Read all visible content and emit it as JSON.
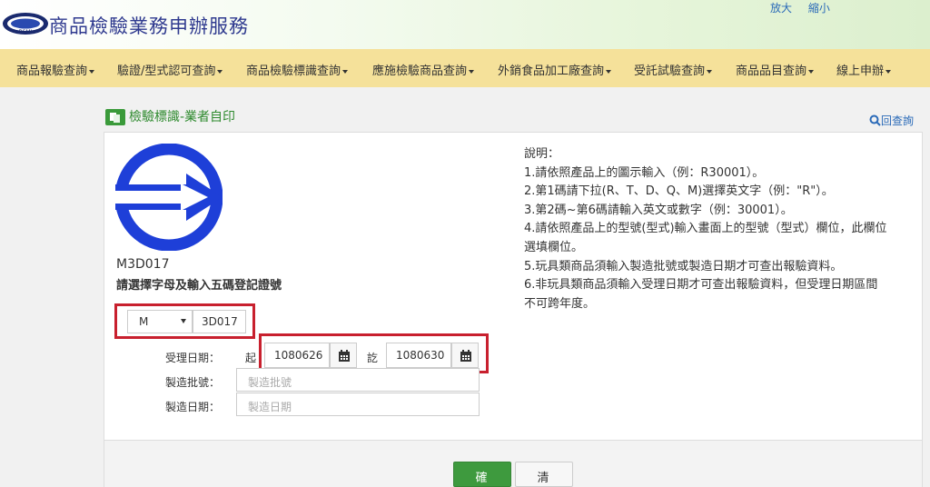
{
  "header": {
    "logo_text": "BSMI",
    "title": "商品檢驗業務申辦服務",
    "enlarge": "放大",
    "shrink": "縮小"
  },
  "nav": [
    {
      "label": "商品報驗查詢"
    },
    {
      "label": "驗證/型式認可查詢"
    },
    {
      "label": "商品檢驗標識查詢"
    },
    {
      "label": "應施檢驗商品查詢"
    },
    {
      "label": "外銷食品加工廠查詢"
    },
    {
      "label": "受託試驗查詢"
    },
    {
      "label": "商品品目查詢"
    },
    {
      "label": "線上申辦"
    }
  ],
  "page": {
    "title": "檢驗標識-業者自印",
    "back": "回查詢"
  },
  "form": {
    "mark_code": "M3D017",
    "instruction": "請選擇字母及輸入五碼登記證號",
    "letter_select": "M",
    "code_value": "3D017",
    "accept_date_label": "受理日期：",
    "from_label": "起",
    "to_label": "訖",
    "date_from": "1080626",
    "date_to": "1080630",
    "batch_label": "製造批號：",
    "batch_placeholder": "製造批號",
    "mfg_date_label": "製造日期：",
    "mfg_date_placeholder": "製造日期"
  },
  "notes": [
    "說明：",
    "1.請依照產品上的圖示輸入（例：R30001）。",
    "2.第1碼請下拉(R、T、D、Q、M)選擇英文字（例：\"R\"）。",
    "3.第2碼~第6碼請輸入英文或數字（例：30001）。",
    "4.請依照產品上的型號(型式)輸入畫面上的型號（型式）欄位，此欄位",
    "選填欄位。",
    "5.玩具類商品須輸入製造批號或製造日期才可查出報驗資料。",
    "6.非玩具類商品須輸入受理日期才可查出報驗資料，但受理日期區間",
    "不可跨年度。"
  ],
  "buttons": {
    "confirm": "確定",
    "clear": "清除"
  },
  "colors": {
    "accent_green": "#3e9a3e",
    "nav_bg": "#f5e19a",
    "highlight_red": "#c8202e",
    "mark_blue": "#1e3fd8"
  }
}
